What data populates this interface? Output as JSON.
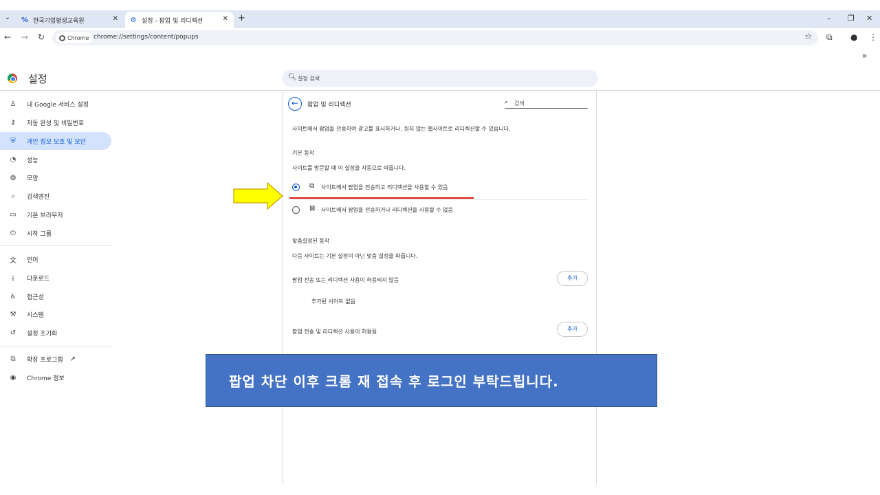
{
  "browser": {
    "tabs": [
      {
        "label": "한국기업평생교육원",
        "icon": "site-favicon"
      },
      {
        "label": "설정 - 팝업 및 리디렉션",
        "icon": "gear-icon"
      }
    ],
    "url_chip": "Chrome",
    "url": "chrome://settings/content/popups"
  },
  "settings": {
    "title": "설정",
    "search_placeholder": "설정 검색"
  },
  "sidebar": {
    "items": [
      {
        "label": "내 Google 서비스 설정",
        "icon": "person-icon"
      },
      {
        "label": "자동 완성 및 비밀번호",
        "icon": "key-icon"
      },
      {
        "label": "개인 정보 보호 및 보안",
        "icon": "shield-icon"
      },
      {
        "label": "성능",
        "icon": "speedometer-icon"
      },
      {
        "label": "모양",
        "icon": "palette-icon"
      },
      {
        "label": "검색엔진",
        "icon": "search-icon"
      },
      {
        "label": "기본 브라우저",
        "icon": "browser-icon"
      },
      {
        "label": "시작 그룹",
        "icon": "power-icon"
      },
      {
        "label": "언어",
        "icon": "translate-icon"
      },
      {
        "label": "다운로드",
        "icon": "download-icon"
      },
      {
        "label": "접근성",
        "icon": "accessibility-icon"
      },
      {
        "label": "시스템",
        "icon": "wrench-icon"
      },
      {
        "label": "설정 초기화",
        "icon": "reset-icon"
      },
      {
        "label": "확장 프로그램",
        "icon": "puzzle-icon"
      },
      {
        "label": "Chrome 정보",
        "icon": "chrome-icon"
      }
    ]
  },
  "page": {
    "title": "팝업 및 리디렉션",
    "search_placeholder": "검색",
    "description": "사이트에서 팝업을 전송하여 광고를 표시하거나, 원치 않는 웹사이트로 리디렉션할 수 있습니다.",
    "default_heading": "기본 동작",
    "default_sub": "사이트를 방문할 때 이 설정을 자동으로 따릅니다.",
    "option_allow": "사이트에서 팝업을 전송하고 리디렉션을 사용할 수 있음",
    "option_block": "사이트에서 팝업을 전송하거나 리디렉션을 사용할 수 없음",
    "selected_option": "allow",
    "custom_heading": "맞춤설정된 동작",
    "custom_sub": "다음 사이트는 기본 설정이 아닌 맞춤 설정을 따릅니다.",
    "blocked_label": "팝업 전송 또는 리디렉션 사용이 허용되지 않음",
    "no_sites": "추가된 사이트 없음",
    "allowed_label": "팝업 전송 및 리디렉션 사용이 허용됨",
    "add_label": "추가"
  },
  "overlay": {
    "notice": "팝업 차단 이후 크롬 재 접속 후 로그인 부탁드립니다.",
    "arrow_color": "#ffff00",
    "underline_color": "#e01010"
  },
  "colors": {
    "accent": "#0b57d0",
    "notice_bg": "#4472c4",
    "tabstrip_bg": "#dfe7f5"
  }
}
